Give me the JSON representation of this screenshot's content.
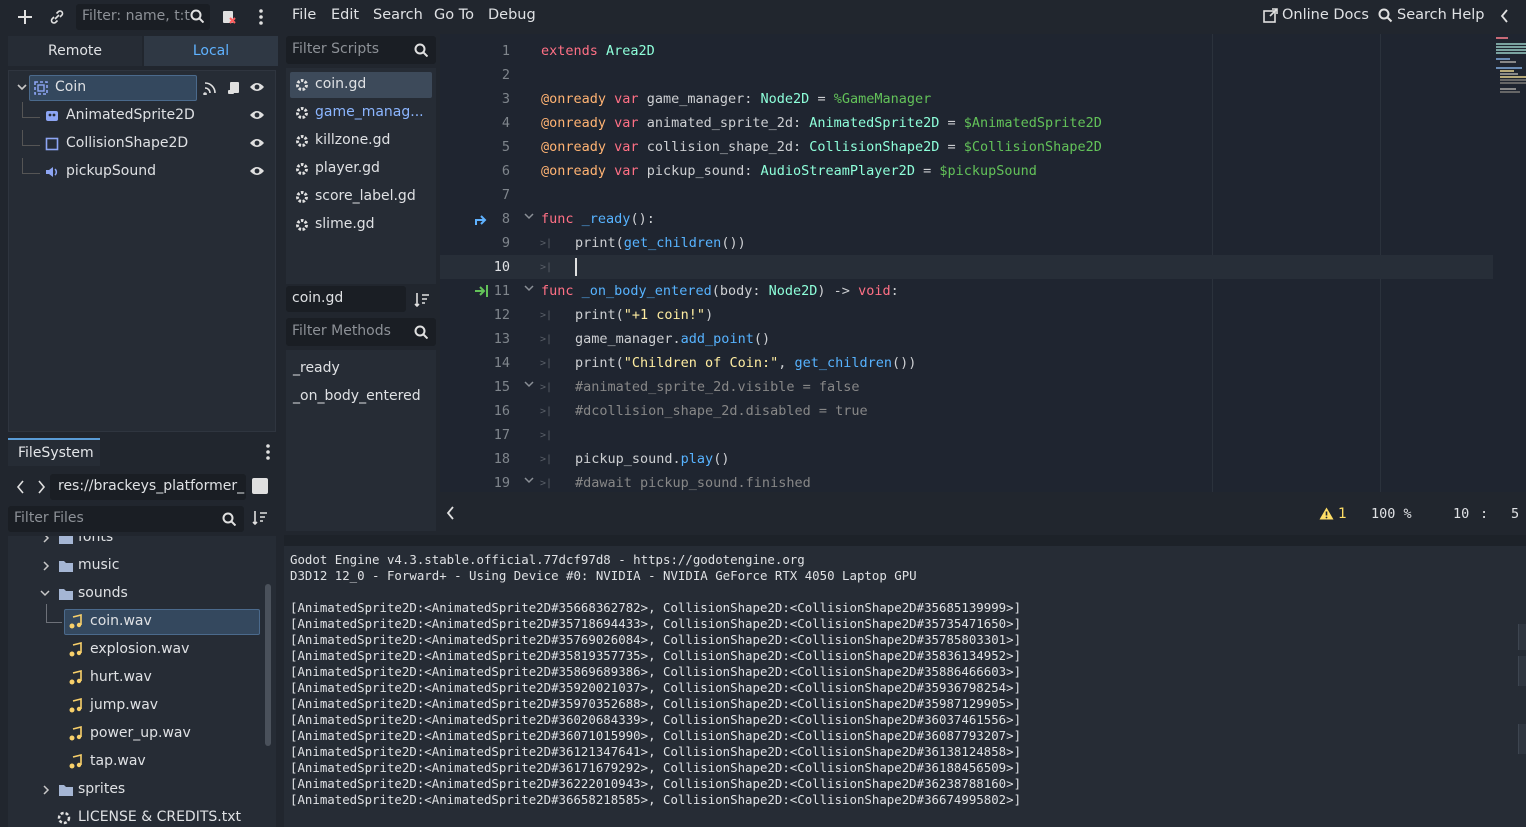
{
  "scene_dock": {
    "filter_placeholder": "Filter: name, t:t",
    "tabs": [
      "Remote",
      "Local"
    ],
    "active_tab": "Local",
    "tree": [
      {
        "label": "Coin",
        "icon": "area2d-icon",
        "selected": true
      },
      {
        "label": "AnimatedSprite2D",
        "icon": "animated-sprite-icon"
      },
      {
        "label": "CollisionShape2D",
        "icon": "collision-shape-icon"
      },
      {
        "label": "pickupSound",
        "icon": "audio-player-icon"
      }
    ]
  },
  "filesystem": {
    "tab_label": "FileSystem",
    "path": "res://brackeys_platformer_",
    "filter_placeholder": "Filter Files",
    "items": [
      {
        "label": "fonts",
        "type": "folder",
        "expanded": false
      },
      {
        "label": "music",
        "type": "folder",
        "expanded": false
      },
      {
        "label": "sounds",
        "type": "folder",
        "expanded": true
      },
      {
        "label": "coin.wav",
        "type": "audio",
        "selected": true
      },
      {
        "label": "explosion.wav",
        "type": "audio"
      },
      {
        "label": "hurt.wav",
        "type": "audio"
      },
      {
        "label": "jump.wav",
        "type": "audio"
      },
      {
        "label": "power_up.wav",
        "type": "audio"
      },
      {
        "label": "tap.wav",
        "type": "audio"
      },
      {
        "label": "sprites",
        "type": "folder",
        "expanded": false
      },
      {
        "label": "LICENSE & CREDITS.txt",
        "type": "text"
      }
    ]
  },
  "menu": {
    "items": [
      "File",
      "Edit",
      "Search",
      "Go To",
      "Debug"
    ],
    "online_docs": "Online Docs",
    "search_help": "Search Help"
  },
  "scripts": {
    "filter_placeholder": "Filter Scripts",
    "list": [
      "coin.gd",
      "game_manag...",
      "killzone.gd",
      "player.gd",
      "score_label.gd",
      "slime.gd"
    ],
    "selected": "coin.gd",
    "current_script": "coin.gd",
    "methods_placeholder": "Filter Methods",
    "methods": [
      "_ready",
      "_on_body_entered"
    ]
  },
  "editor": {
    "line_numbers": [
      "1",
      "2",
      "3",
      "4",
      "5",
      "6",
      "7",
      "8",
      "9",
      "10",
      "11",
      "12",
      "13",
      "14",
      "15",
      "16",
      "17",
      "18",
      "19"
    ],
    "current_line": "10",
    "status": {
      "warnings": "1",
      "zoom": "100 %",
      "line": "10",
      "col": "5"
    }
  },
  "output": {
    "lines": [
      "Godot Engine v4.3.stable.official.77dcf97d8 - https://godotengine.org",
      "D3D12 12_0 - Forward+ - Using Device #0: NVIDIA - NVIDIA GeForce RTX 4050 Laptop GPU",
      "",
      "[AnimatedSprite2D:<AnimatedSprite2D#35668362782>, CollisionShape2D:<CollisionShape2D#35685139999>]",
      "[AnimatedSprite2D:<AnimatedSprite2D#35718694433>, CollisionShape2D:<CollisionShape2D#35735471650>]",
      "[AnimatedSprite2D:<AnimatedSprite2D#35769026084>, CollisionShape2D:<CollisionShape2D#35785803301>]",
      "[AnimatedSprite2D:<AnimatedSprite2D#35819357735>, CollisionShape2D:<CollisionShape2D#35836134952>]",
      "[AnimatedSprite2D:<AnimatedSprite2D#35869689386>, CollisionShape2D:<CollisionShape2D#35886466603>]",
      "[AnimatedSprite2D:<AnimatedSprite2D#35920021037>, CollisionShape2D:<CollisionShape2D#35936798254>]",
      "[AnimatedSprite2D:<AnimatedSprite2D#35970352688>, CollisionShape2D:<CollisionShape2D#35987129905>]",
      "[AnimatedSprite2D:<AnimatedSprite2D#36020684339>, CollisionShape2D:<CollisionShape2D#36037461556>]",
      "[AnimatedSprite2D:<AnimatedSprite2D#36071015990>, CollisionShape2D:<CollisionShape2D#36087793207>]",
      "[AnimatedSprite2D:<AnimatedSprite2D#36121347641>, CollisionShape2D:<CollisionShape2D#36138124858>]",
      "[AnimatedSprite2D:<AnimatedSprite2D#36171679292>, CollisionShape2D:<CollisionShape2D#36188456509>]",
      "[AnimatedSprite2D:<AnimatedSprite2D#36222010943>, CollisionShape2D:<CollisionShape2D#36238788160>]",
      "[AnimatedSprite2D:<AnimatedSprite2D#36658218585>, CollisionShape2D:<CollisionShape2D#36674995802>]"
    ]
  },
  "code_tokens": {
    "l1": [
      "extends",
      "Area2D"
    ],
    "l3": [
      "@onready",
      "var",
      "game_manager:",
      "Node2D",
      "=",
      "%GameManager"
    ],
    "l4": [
      "@onready",
      "var",
      "animated_sprite_2d:",
      "AnimatedSprite2D",
      "=",
      "$AnimatedSprite2D"
    ],
    "l5": [
      "@onready",
      "var",
      "collision_shape_2d:",
      "CollisionShape2D",
      "=",
      "$CollisionShape2D"
    ],
    "l6": [
      "@onready",
      "var",
      "pickup_sound:",
      "AudioStreamPlayer2D",
      "=",
      "$pickupSound"
    ],
    "l8": [
      "func",
      "_ready",
      "():"
    ],
    "l9": [
      "print",
      "(",
      "get_children",
      "())"
    ],
    "l11": [
      "func",
      "_on_body_entered",
      "(body:",
      "Node2D",
      ") ->",
      "void",
      ":"
    ],
    "l12": [
      "print",
      "(",
      "\"+1 coin!\"",
      ")"
    ],
    "l13": [
      "game_manager.",
      "add_point",
      "()"
    ],
    "l14": [
      "print",
      "(",
      "\"Children of Coin:\"",
      ", ",
      "get_children",
      "())"
    ],
    "l15": [
      "#animated_sprite_2d.visible = false"
    ],
    "l16": [
      "#dcollision_shape_2d.disabled = true"
    ],
    "l18": [
      "pickup_sound.",
      "play",
      "()"
    ],
    "l19": [
      "#dawait pickup_sound.finished"
    ]
  },
  "colors": {
    "accent": "#5a9cd6",
    "selection": "#34485e",
    "keyword": "#ff7085",
    "type": "#8effda",
    "string": "#ffeda1",
    "function": "#57b3ff",
    "comment": "#878787",
    "node_path": "#63c259",
    "warning": "#ffde66"
  }
}
